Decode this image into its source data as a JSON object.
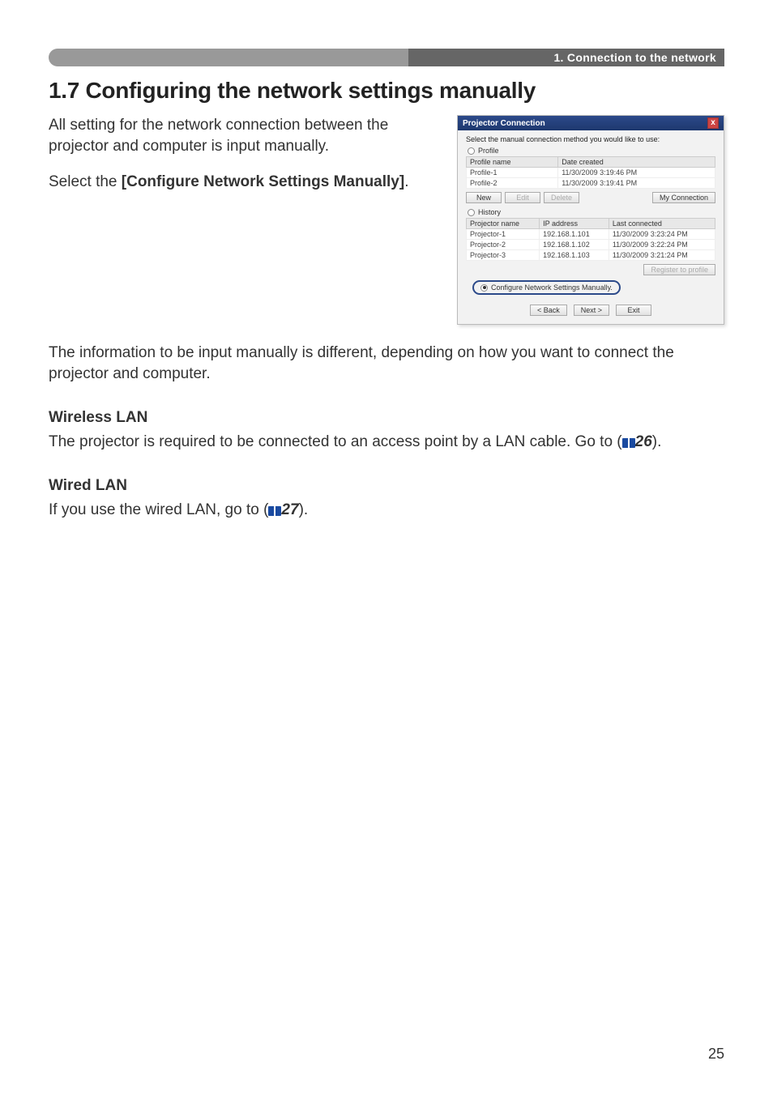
{
  "header": {
    "chapter_label": "1. Connection to the network"
  },
  "section": {
    "title": "1.7 Configuring the network settings manually"
  },
  "intro": {
    "p1": "All setting for the network connection between the projector and computer is input manually.",
    "p2_a": "Select the ",
    "p2_b": "[Configure Network Settings Manually]",
    "p2_c": "."
  },
  "after": {
    "p": "The information to be input manually is different, depending on how you want to connect the projector and computer."
  },
  "wireless": {
    "heading": "Wireless LAN",
    "text_a": "The projector is required to be connected to an access point by a LAN cable. Go to (",
    "page_ref": "26",
    "text_b": ")."
  },
  "wired": {
    "heading": "Wired LAN",
    "text_a": "If you use the wired LAN, go to (",
    "page_ref": "27",
    "text_b": ")."
  },
  "dialog": {
    "title": "Projector Connection",
    "instruction": "Select the manual connection method you would like to use:",
    "profile": {
      "label": "Profile",
      "col_name": "Profile name",
      "col_date": "Date created",
      "rows": [
        {
          "name": "Profile-1",
          "date": "11/30/2009 3:19:46 PM"
        },
        {
          "name": "Profile-2",
          "date": "11/30/2009 3:19:41 PM"
        }
      ],
      "btn_new": "New",
      "btn_edit": "Edit",
      "btn_delete": "Delete",
      "btn_myconn": "My Connection"
    },
    "history": {
      "label": "History",
      "col_name": "Projector name",
      "col_ip": "IP address",
      "col_last": "Last connected",
      "rows": [
        {
          "name": "Projector-1",
          "ip": "192.168.1.101",
          "last": "11/30/2009 3:23:24 PM"
        },
        {
          "name": "Projector-2",
          "ip": "192.168.1.102",
          "last": "11/30/2009 3:22:24 PM"
        },
        {
          "name": "Projector-3",
          "ip": "192.168.1.103",
          "last": "11/30/2009 3:21:24 PM"
        }
      ],
      "btn_register": "Register to profile"
    },
    "manual": {
      "label": "Configure Network Settings Manually."
    },
    "nav": {
      "back": "< Back",
      "next": "Next >",
      "exit": "Exit"
    }
  },
  "page_number": "25"
}
